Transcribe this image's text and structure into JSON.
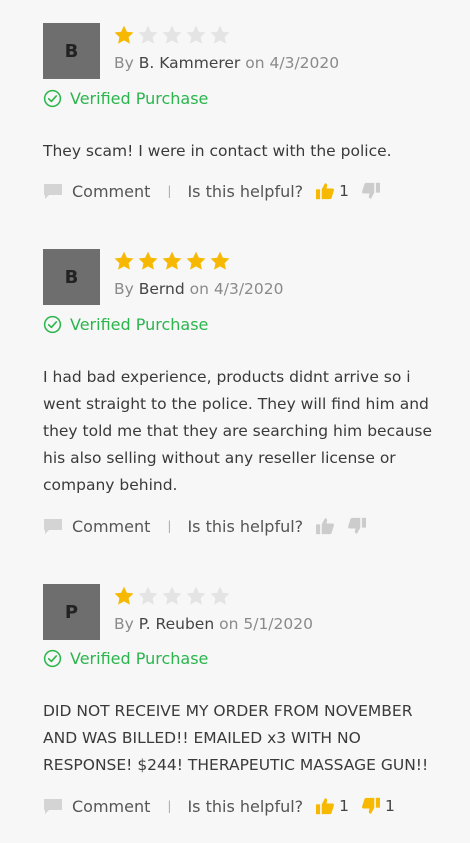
{
  "colors": {
    "star_filled": "#f6b800",
    "star_empty": "#e4e4e4",
    "verified_green": "#2bb54d",
    "thumb_active": "#f6b800",
    "thumb_inactive": "#cccccc",
    "avatar_bg": "#6e6e6e",
    "background": "#f7f7f7"
  },
  "labels": {
    "by": "By",
    "on": "on",
    "verified": "Verified Purchase",
    "comment": "Comment",
    "separator": "|",
    "helpful": "Is this helpful?"
  },
  "reviews": [
    {
      "initial": "B",
      "rating": 1,
      "max_rating": 5,
      "author": "B. Kammerer",
      "date": "4/3/2020",
      "text": "They scam! I were in contact with the police.",
      "helpful_up": "1",
      "helpful_down": "",
      "up_active": true,
      "down_active": false
    },
    {
      "initial": "B",
      "rating": 5,
      "max_rating": 5,
      "author": "Bernd",
      "date": "4/3/2020",
      "text": "I had bad experience, products didnt arrive so i went straight to the police. They will find him and they told me that they are searching him because his also selling without any reseller license or company behind.",
      "helpful_up": "",
      "helpful_down": "",
      "up_active": false,
      "down_active": false
    },
    {
      "initial": "P",
      "rating": 1,
      "max_rating": 5,
      "author": "P. Reuben",
      "date": "5/1/2020",
      "text": "DID NOT RECEIVE MY ORDER FROM NOVEMBER AND WAS BILLED!! EMAILED x3 WITH NO RESPONSE! $244! THERAPEUTIC MASSAGE GUN!!",
      "helpful_up": "1",
      "helpful_down": "1",
      "up_active": true,
      "down_active": true
    }
  ]
}
